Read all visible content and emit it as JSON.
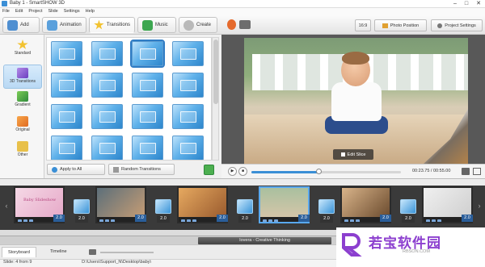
{
  "window": {
    "title": "Baby 1 - SmartSHOW 3D",
    "controls": [
      "–",
      "□",
      "✕"
    ]
  },
  "menu": [
    "File",
    "Edit",
    "Project",
    "Slide",
    "Settings",
    "Help"
  ],
  "toolbar": {
    "tabs": [
      {
        "label": "Add",
        "icon": "add-icon"
      },
      {
        "label": "Animation",
        "icon": "animation-icon"
      },
      {
        "label": "Transitions",
        "icon": "transitions-icon"
      },
      {
        "label": "Music",
        "icon": "music-icon"
      },
      {
        "label": "Create",
        "icon": "create-icon"
      }
    ],
    "right": {
      "ratio": "16:9",
      "photo_position": "Photo Position",
      "project_settings": "Project Settings"
    }
  },
  "categories": [
    {
      "label": "Standard",
      "icon": "star-icon"
    },
    {
      "label": "3D Transitions",
      "icon": "3d-icon"
    },
    {
      "label": "Gradient",
      "icon": "gradient-icon"
    },
    {
      "label": "Original",
      "icon": "original-icon"
    },
    {
      "label": "Other",
      "icon": "folder-icon"
    }
  ],
  "transitions": {
    "count": 20,
    "selected_index": 2,
    "apply_all": "Apply to All",
    "random": "Random Transitions"
  },
  "preview": {
    "edit_slice": "Edit Slice"
  },
  "player": {
    "timecode": "00:23.75 / 00:55.00",
    "progress_fraction": 0.45
  },
  "timeline": {
    "slide_durations": [
      "2.0",
      "2.0",
      "2.0",
      "2.0",
      "2.0",
      "2.0"
    ],
    "transition_durations": [
      "2.0",
      "2.0",
      "2.0",
      "2.0",
      "2.0",
      "2.0"
    ],
    "slide_caption": "Baby Slideshow",
    "music_track": "Iovera - Creative Thinking"
  },
  "bottom_tabs": [
    "Storyboard",
    "Timeline"
  ],
  "status": {
    "slide": "Slide: 4 from 9",
    "path": "D:\\Users\\Support_N\\Desktop\\baby\\"
  },
  "colors": {
    "accent": "#3b8fd6",
    "toolbar_bg": "#e4e4e4",
    "watermark": "#8c3fcf"
  },
  "watermark": {
    "text": "若宝软件园",
    "url": "RBSON.COM"
  }
}
